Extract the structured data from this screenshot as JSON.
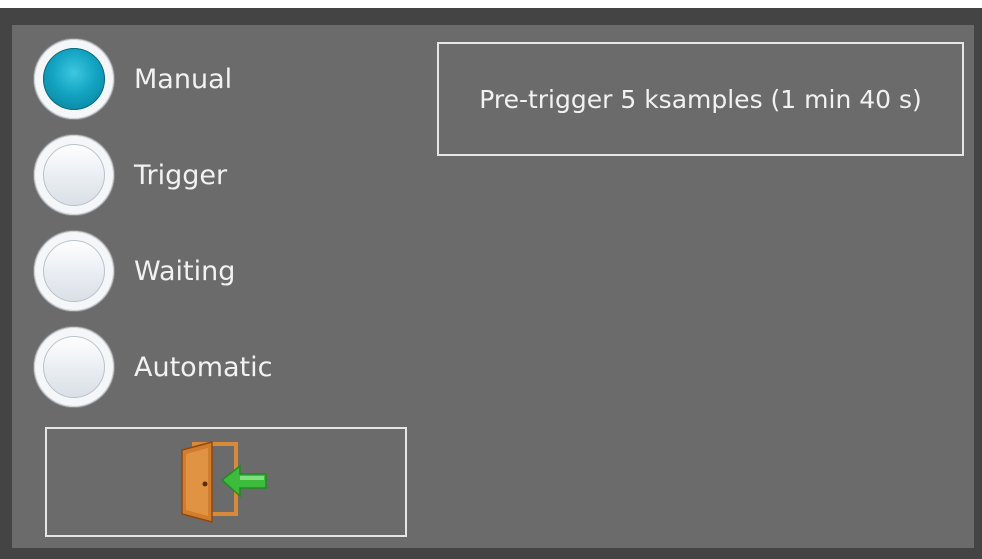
{
  "modes": [
    {
      "label": "Manual",
      "selected": true
    },
    {
      "label": "Trigger",
      "selected": false
    },
    {
      "label": "Waiting",
      "selected": false
    },
    {
      "label": "Automatic",
      "selected": false
    }
  ],
  "pretrigger": {
    "text": "Pre-trigger 5 ksamples (1 min 40 s)"
  },
  "exit_button": {
    "icon": "exit-door-icon"
  },
  "colors": {
    "panel_bg": "#6b6b6b",
    "frame_bg": "#444444",
    "radio_selected": "#12a4c2",
    "text": "#f2f2f2",
    "door": "#d88a3a",
    "arrow": "#3dbb3d"
  }
}
